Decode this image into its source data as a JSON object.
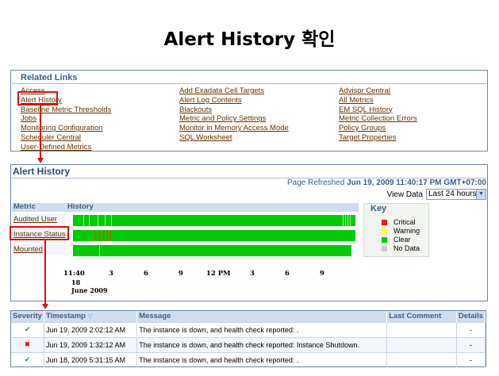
{
  "slide_title": "Alert History 확인",
  "related_links": {
    "title": "Related Links",
    "col1": [
      "Access",
      "Alert History",
      "Baseline Metric Thresholds",
      "Jobs",
      "Monitoring Configuration",
      "Scheduler Central",
      "User-Defined Metrics"
    ],
    "col2": [
      "Add Exadata Cell Targets",
      "Alert Log Contents",
      "Blackouts",
      "Metric and Policy Settings",
      "Monitor in Memory Access Mode",
      "SQL Worksheet"
    ],
    "col3": [
      "Advisor Central",
      "All Metrics",
      "EM SQL History",
      "Metric Collection Errors",
      "Policy Groups",
      "Target Properties"
    ]
  },
  "alert_history": {
    "title": "Alert History",
    "refresh_label": "Page Refreshed",
    "refresh_time": "Jun 19, 2009 11:40:17 PM GMT+07:00",
    "view_data_label": "View Data",
    "view_data_value": "Last 24 hours",
    "metric_header": "Metric",
    "history_header": "History",
    "metrics": [
      {
        "name": "Audited User"
      },
      {
        "name": "Instance Status"
      },
      {
        "name": "Mounted"
      }
    ],
    "axis_ticks": [
      "11:40",
      "3",
      "6",
      "9",
      "12 PM",
      "3",
      "6",
      "9"
    ],
    "axis_day": "18",
    "axis_month": "June 2009"
  },
  "key": {
    "title": "Key",
    "items": [
      {
        "label": "Critical",
        "color": "#e02020"
      },
      {
        "label": "Warning",
        "color": "#ffff33"
      },
      {
        "label": "Clear",
        "color": "#00cc00"
      },
      {
        "label": "No Data",
        "color": "#cccccc"
      }
    ]
  },
  "alerts_table": {
    "headers": [
      "Severity",
      "Timestamp",
      "Message",
      "Last Comment",
      "Details"
    ],
    "rows": [
      {
        "severity": "clear",
        "timestamp": "Jun 19, 2009 2:02:12 AM",
        "message": "The instance is down, and health check reported: .",
        "comment": "",
        "details": "-"
      },
      {
        "severity": "critical",
        "timestamp": "Jun 19, 2009 1:32:12 AM",
        "message": "The instance is down, and health check reported: Instance Shutdown.",
        "comment": "",
        "details": "-"
      },
      {
        "severity": "clear",
        "timestamp": "Jun 18, 2009 5:31:15 AM",
        "message": "The instance is down, and health check reported: .",
        "comment": "",
        "details": "-"
      }
    ]
  },
  "colors": {
    "clear": "#00cc00",
    "critical": "#e02020",
    "instance_event": "#8c7a00",
    "highlight": "#e01010"
  }
}
